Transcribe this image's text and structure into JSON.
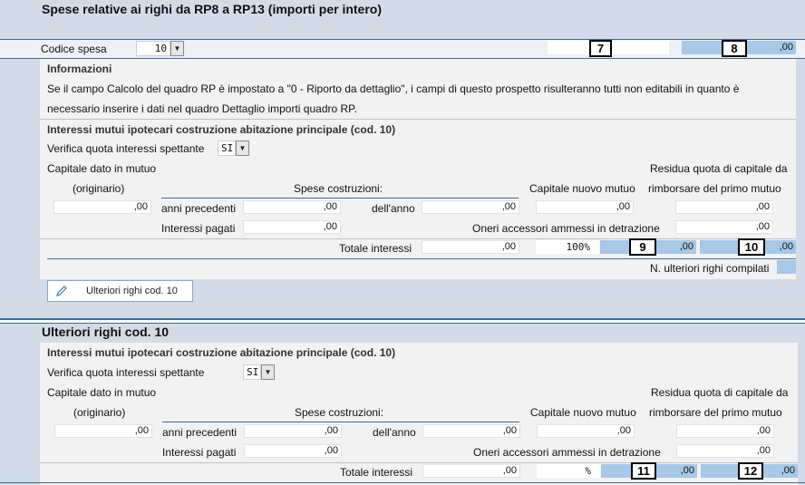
{
  "section1": {
    "title": "Spese relative ai righi da RP8 a RP13 (importi per intero)",
    "codice_label": "Codice spesa",
    "codice_value": "10",
    "marker7": "7",
    "marker8": "8",
    "amount8": ",00",
    "info_title": "Informazioni",
    "info_line1": "Se il campo Calcolo del quadro RP è impostato a \"0 - Riporto da dettaglio\", i campi di questo prospetto risulteranno tutti non editabili in quanto è",
    "info_line2": "necessario inserire i dati nel quadro Dettaglio importi quadro RP.",
    "group_title": "Interessi mutui ipotecari costruzione abitazione principale (cod. 10)",
    "verifica_label": "Verifica quota interessi spettante",
    "verifica_value": "SI",
    "capitale_label": "Capitale dato in mutuo",
    "originario_label": "(originario)",
    "capitale_value": ",00",
    "spese_label": "Spese costruzioni:",
    "anni_label": "anni precedenti",
    "anni_value": ",00",
    "anno_label": "dell'anno",
    "anno_value": ",00",
    "nuovo_label": "Capitale nuovo mutuo",
    "nuovo_value": ",00",
    "residua1_label": "Residua quota di capitale da",
    "residua2_label": "rimborsare del primo mutuo",
    "residua_value": ",00",
    "interessi_label": "Interessi pagati",
    "interessi_value": ",00",
    "oneri_label": "Oneri accessori ammessi in detrazione",
    "oneri_value": ",00",
    "totale_label": "Totale interessi",
    "totale_value": ",00",
    "percent_value": "100%",
    "marker9": "9",
    "amount9": ",00",
    "marker10": "10",
    "amount10": ",00",
    "ulteriori_count_label": "N. ulteriori righi compilati",
    "button_label": "Ulteriori righi cod. 10"
  },
  "section2": {
    "title": "Ulteriori righi cod. 10",
    "group_title": "Interessi mutui ipotecari costruzione abitazione principale (cod. 10)",
    "verifica_label": "Verifica quota interessi spettante",
    "verifica_value": "SI",
    "capitale_label": "Capitale dato in mutuo",
    "originario_label": "(originario)",
    "capitale_value": ",00",
    "spese_label": "Spese costruzioni:",
    "anni_label": "anni precedenti",
    "anni_value": ",00",
    "anno_label": "dell'anno",
    "anno_value": ",00",
    "nuovo_label": "Capitale nuovo mutuo",
    "nuovo_value": ",00",
    "residua1_label": "Residua quota di capitale da",
    "residua2_label": "rimborsare del primo mutuo",
    "residua_value": ",00",
    "interessi_label": "Interessi pagati",
    "interessi_value": ",00",
    "oneri_label": "Oneri accessori ammessi in detrazione",
    "oneri_value": ",00",
    "totale_label": "Totale interessi",
    "totale_value": ",00",
    "percent_value": "%",
    "marker11": "11",
    "amount11": ",00",
    "marker12": "12",
    "amount12": ",00"
  },
  "colors": {
    "header_bg": "#d3dbe6",
    "panel_bg": "#f2f2f2",
    "field_blue": "#a7c8e6",
    "rule_blue": "#3f6a9a"
  }
}
